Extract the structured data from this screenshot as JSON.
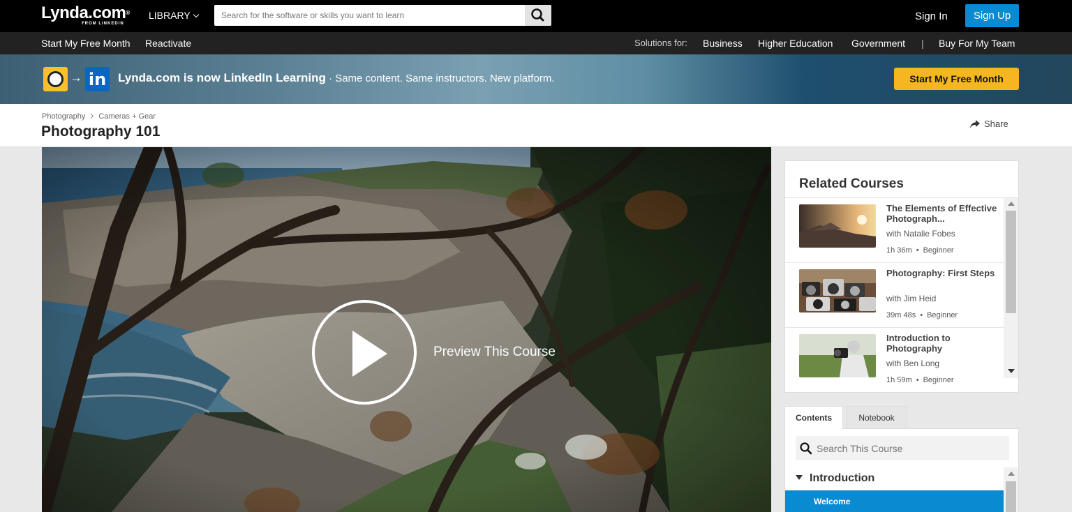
{
  "header": {
    "logo_main": "Lynda.com",
    "logo_reg": "®",
    "logo_sub": "FROM LINKEDIN",
    "library_label": "LIBRARY",
    "search_placeholder": "Search for the software or skills you want to learn",
    "signin_label": "Sign In",
    "signup_label": "Sign Up"
  },
  "subnav": {
    "free_month": "Start My Free Month",
    "reactivate": "Reactivate",
    "solutions_label": "Solutions for:",
    "business": "Business",
    "higher_ed": "Higher Education",
    "government": "Government",
    "divider": "|",
    "buy_team": "Buy For My Team"
  },
  "banner": {
    "arrow": "→",
    "in_logo": "in",
    "headline": "Lynda.com is now LinkedIn Learning",
    "tagline": " · Same content. Same instructors. New platform.",
    "cta": "Start My Free Month"
  },
  "course": {
    "breadcrumb": [
      "Photography",
      "Cameras + Gear"
    ],
    "title": "Photography 101",
    "share_label": "Share",
    "preview_label": "Preview This Course"
  },
  "related": {
    "heading": "Related Courses",
    "items": [
      {
        "title": "The Elements of Effective Photograph...",
        "author": "with Natalie Fobes",
        "duration": "1h 36m",
        "level": "Beginner"
      },
      {
        "title": "Photography: First Steps",
        "author": "with Jim Heid",
        "duration": "39m 48s",
        "level": "Beginner"
      },
      {
        "title": "Introduction to Photography",
        "author": "with Ben Long",
        "duration": "1h 59m",
        "level": "Beginner"
      }
    ],
    "dot": "•"
  },
  "contents": {
    "tab_contents": "Contents",
    "tab_notebook": "Notebook",
    "search_placeholder": "Search This Course",
    "chapter": "Introduction",
    "selected_item": "Welcome"
  },
  "colors": {
    "accent_blue": "#0a8ad0",
    "cta_yellow": "#f5b61f",
    "topbar": "#000000",
    "subnav": "#222222"
  }
}
